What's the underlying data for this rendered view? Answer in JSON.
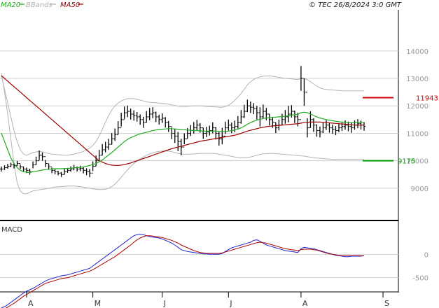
{
  "header": {
    "legend": [
      {
        "label": "MA20",
        "color": "#22aa22"
      },
      {
        "label": "BBands",
        "color": "#b0b0b0"
      },
      {
        "label": "MA50",
        "color": "#990000"
      }
    ],
    "copyright": "© TEC 26/8/2024 3:0 GMT"
  },
  "chart_data": [
    {
      "type": "ohlc",
      "title": "",
      "ylim": [
        7900,
        15500
      ],
      "yticks": [
        9000,
        10000,
        11000,
        12000,
        13000,
        14000
      ],
      "ytick_labels": [
        "9000",
        "10000",
        "11000",
        "12000",
        "13000",
        "14000"
      ],
      "x_months": [
        {
          "label": "A",
          "index": 8
        },
        {
          "label": "M",
          "index": 29
        },
        {
          "label": "J",
          "index": 51
        },
        {
          "label": "J",
          "index": 72
        },
        {
          "label": "A",
          "index": 95
        },
        {
          "label": "S",
          "index": 121
        }
      ],
      "n_slots": 125,
      "close": [
        9700,
        9750,
        9800,
        9850,
        9820,
        9900,
        9780,
        9700,
        9650,
        9600,
        9850,
        10000,
        10200,
        10150,
        9900,
        9780,
        9650,
        9600,
        9550,
        9500,
        9600,
        9650,
        9700,
        9750,
        9700,
        9720,
        9650,
        9600,
        9550,
        9800,
        10000,
        10200,
        10400,
        10500,
        10600,
        10800,
        10950,
        11200,
        11500,
        11750,
        11800,
        11700,
        11650,
        11600,
        11500,
        11400,
        11600,
        11700,
        11750,
        11600,
        11500,
        11550,
        11400,
        11250,
        11000,
        10900,
        10700,
        10500,
        10800,
        11000,
        11100,
        11200,
        11300,
        11200,
        11000,
        11050,
        11100,
        11200,
        11000,
        10800,
        10900,
        11200,
        11300,
        11200,
        11250,
        11400,
        11600,
        11800,
        12000,
        11950,
        11900,
        11750,
        11600,
        11800,
        11700,
        11500,
        11400,
        11200,
        11300,
        11500,
        11600,
        11700,
        11800,
        11600,
        11500,
        13000,
        12500,
        11200,
        11500,
        11300,
        11100,
        11050,
        11200,
        11300,
        11200,
        11150,
        11100,
        11200,
        11250,
        11300,
        11250,
        11200,
        11300,
        11350,
        11300,
        11250
      ],
      "range": [
        180,
        170,
        180,
        160,
        200,
        190,
        170,
        180,
        200,
        220,
        250,
        300,
        350,
        300,
        260,
        220,
        200,
        180,
        160,
        180,
        200,
        180,
        190,
        200,
        180,
        200,
        220,
        250,
        300,
        350,
        380,
        400,
        420,
        380,
        400,
        420,
        450,
        480,
        500,
        450,
        420,
        400,
        380,
        350,
        380,
        400,
        420,
        450,
        400,
        380,
        360,
        350,
        380,
        400,
        420,
        500,
        700,
        600,
        400,
        380,
        400,
        420,
        380,
        350,
        400,
        380,
        360,
        400,
        450,
        500,
        600,
        450,
        400,
        380,
        420,
        460,
        500,
        480,
        450,
        420,
        400,
        500,
        700,
        500,
        450,
        420,
        400,
        380,
        400,
        420,
        500,
        600,
        450,
        450,
        500,
        900,
        1000,
        700,
        600,
        500,
        450,
        400,
        380,
        360,
        350,
        340,
        330,
        320,
        330,
        340,
        350,
        360,
        340,
        330,
        320,
        310
      ],
      "ma20": [
        11000,
        10700,
        10400,
        10100,
        9900,
        9750,
        9650,
        9600,
        9580,
        9570,
        9600,
        9620,
        9640,
        9660,
        9680,
        9690,
        9700,
        9710,
        9710,
        9710,
        9720,
        9720,
        9730,
        9740,
        9750,
        9760,
        9780,
        9800,
        9830,
        9860,
        9900,
        9960,
        10030,
        10120,
        10210,
        10300,
        10400,
        10500,
        10600,
        10700,
        10780,
        10840,
        10890,
        10940,
        10980,
        11010,
        11040,
        11070,
        11100,
        11120,
        11140,
        11150,
        11160,
        11170,
        11170,
        11160,
        11150,
        11140,
        11130,
        11120,
        11110,
        11100,
        11100,
        11090,
        11080,
        11080,
        11080,
        11080,
        11080,
        11070,
        11060,
        11070,
        11080,
        11100,
        11120,
        11150,
        11200,
        11260,
        11330,
        11390,
        11440,
        11480,
        11510,
        11540,
        11560,
        11570,
        11580,
        11590,
        11600,
        11610,
        11620,
        11640,
        11660,
        11680,
        11690,
        11750,
        11770,
        11750,
        11700,
        11650,
        11600,
        11560,
        11530,
        11500,
        11480,
        11460,
        11440,
        11420,
        11410,
        11400,
        11390,
        11390,
        11390,
        11400,
        11400,
        11400
      ],
      "ma50": [
        13100,
        13000,
        12900,
        12800,
        12700,
        12600,
        12500,
        12400,
        12300,
        12200,
        12100,
        12000,
        11900,
        11800,
        11700,
        11600,
        11500,
        11400,
        11300,
        11200,
        11100,
        11000,
        10900,
        10800,
        10700,
        10600,
        10500,
        10400,
        10300,
        10200,
        10100,
        10000,
        9950,
        9900,
        9860,
        9840,
        9830,
        9830,
        9840,
        9860,
        9890,
        9920,
        9960,
        10000,
        10040,
        10080,
        10120,
        10160,
        10200,
        10240,
        10280,
        10320,
        10360,
        10400,
        10440,
        10470,
        10500,
        10530,
        10560,
        10590,
        10620,
        10650,
        10680,
        10710,
        10730,
        10750,
        10770,
        10790,
        10810,
        10830,
        10850,
        10870,
        10890,
        10910,
        10930,
        10960,
        11000,
        11040,
        11080,
        11110,
        11140,
        11170,
        11200,
        11220,
        11240,
        11260,
        11270,
        11280,
        11290,
        11300,
        11310,
        11320,
        11330,
        11340,
        11350,
        11370,
        11390,
        11400,
        11410,
        11410,
        11410,
        11410,
        11400,
        11390,
        11380,
        11370,
        11360,
        11350,
        11340,
        11330,
        11320,
        11310,
        11300,
        11300,
        11300,
        11300
      ],
      "bb_upper": [
        13100,
        12600,
        12100,
        11600,
        11100,
        10700,
        10400,
        10250,
        10200,
        10250,
        10300,
        10320,
        10340,
        10320,
        10290,
        10270,
        10240,
        10230,
        10220,
        10210,
        10200,
        10200,
        10220,
        10240,
        10270,
        10300,
        10340,
        10390,
        10460,
        10560,
        10700,
        10900,
        11150,
        11400,
        11650,
        11850,
        12000,
        12100,
        12180,
        12230,
        12260,
        12270,
        12260,
        12240,
        12210,
        12180,
        12150,
        12130,
        12120,
        12110,
        12100,
        12090,
        12080,
        12060,
        12040,
        12010,
        11990,
        11980,
        11980,
        11980,
        11990,
        12000,
        12000,
        12000,
        11990,
        11980,
        11970,
        11970,
        11960,
        11950,
        11950,
        11980,
        12020,
        12100,
        12200,
        12320,
        12450,
        12600,
        12760,
        12880,
        12960,
        13020,
        13060,
        13080,
        13090,
        13090,
        13080,
        13060,
        13040,
        13020,
        13000,
        12990,
        12980,
        12970,
        12960,
        13000,
        13000,
        12950,
        12880,
        12800,
        12720,
        12660,
        12620,
        12600,
        12590,
        12580,
        12570,
        12560,
        12550,
        12550,
        12550,
        12550,
        12550,
        12550,
        12550,
        12550
      ],
      "bb_lower": [
        13200,
        12500,
        11700,
        10800,
        9900,
        9200,
        8900,
        8800,
        8800,
        8850,
        8900,
        8920,
        8940,
        8960,
        8980,
        9000,
        9020,
        9040,
        9050,
        9060,
        9070,
        9080,
        9080,
        9080,
        9070,
        9060,
        9040,
        9020,
        9000,
        8980,
        8960,
        8950,
        8950,
        8960,
        9000,
        9060,
        9150,
        9270,
        9400,
        9540,
        9670,
        9790,
        9900,
        9990,
        10070,
        10140,
        10200,
        10250,
        10290,
        10320,
        10340,
        10350,
        10350,
        10350,
        10330,
        10300,
        10270,
        10250,
        10240,
        10240,
        10240,
        10250,
        10260,
        10270,
        10270,
        10270,
        10270,
        10270,
        10260,
        10240,
        10220,
        10200,
        10180,
        10160,
        10140,
        10120,
        10110,
        10110,
        10120,
        10140,
        10170,
        10200,
        10230,
        10250,
        10260,
        10270,
        10270,
        10260,
        10250,
        10240,
        10230,
        10220,
        10210,
        10200,
        10190,
        10180,
        10170,
        10150,
        10130,
        10110,
        10100,
        10090,
        10080,
        10070,
        10060,
        10050,
        10050,
        10050,
        10050,
        10050,
        10050,
        10050,
        10050,
        10050,
        10050,
        10050
      ]
    },
    {
      "type": "line",
      "title": "MACD",
      "ylim": [
        -760,
        680
      ],
      "yticks": [
        0,
        -500
      ],
      "ytick_labels": [
        "0",
        "-500"
      ],
      "series": [
        {
          "color": "#2222cc",
          "values": [
            -1150,
            -1120,
            -1080,
            -1030,
            -980,
            -930,
            -880,
            -830,
            -790,
            -760,
            -730,
            -690,
            -650,
            -610,
            -570,
            -540,
            -520,
            -500,
            -480,
            -460,
            -450,
            -440,
            -420,
            -400,
            -380,
            -360,
            -340,
            -320,
            -300,
            -250,
            -200,
            -150,
            -100,
            -50,
            0,
            50,
            100,
            150,
            200,
            250,
            300,
            350,
            400,
            420,
            430,
            420,
            400,
            380,
            370,
            360,
            350,
            330,
            300,
            270,
            240,
            200,
            150,
            100,
            80,
            60,
            50,
            40,
            30,
            20,
            10,
            10,
            0,
            0,
            0,
            0,
            20,
            60,
            100,
            140,
            160,
            180,
            200,
            220,
            240,
            260,
            300,
            310,
            280,
            240,
            200,
            180,
            160,
            140,
            120,
            100,
            80,
            70,
            60,
            50,
            40,
            120,
            150,
            140,
            130,
            120,
            100,
            80,
            60,
            40,
            20,
            0,
            -20,
            -30,
            -40,
            -50,
            -50,
            -40,
            -40,
            -40,
            -40,
            -30
          ]
        },
        {
          "color": "#aa0000",
          "values": [
            -1200,
            -1170,
            -1130,
            -1090,
            -1050,
            -1000,
            -950,
            -900,
            -860,
            -820,
            -780,
            -740,
            -700,
            -660,
            -620,
            -600,
            -580,
            -560,
            -540,
            -520,
            -510,
            -500,
            -480,
            -460,
            -440,
            -420,
            -400,
            -380,
            -360,
            -330,
            -290,
            -250,
            -210,
            -170,
            -130,
            -90,
            -50,
            0,
            50,
            100,
            150,
            200,
            260,
            310,
            350,
            380,
            400,
            400,
            390,
            380,
            370,
            360,
            340,
            320,
            300,
            270,
            240,
            200,
            170,
            140,
            110,
            80,
            60,
            40,
            30,
            20,
            20,
            20,
            20,
            20,
            30,
            50,
            70,
            90,
            110,
            130,
            150,
            170,
            190,
            210,
            230,
            250,
            260,
            250,
            240,
            220,
            200,
            180,
            160,
            140,
            120,
            110,
            100,
            90,
            80,
            100,
            110,
            110,
            110,
            100,
            90,
            70,
            50,
            30,
            10,
            0,
            -10,
            -20,
            -30,
            -30,
            -30,
            -30,
            -30,
            -30,
            -30,
            -30
          ]
        }
      ],
      "yticks_actual": [
        0,
        -500
      ]
    }
  ],
  "levels": [
    {
      "value": 12300,
      "label": "11943",
      "color": "#cc0000"
    },
    {
      "value": 10000,
      "label": "9175",
      "color": "#009900"
    }
  ]
}
